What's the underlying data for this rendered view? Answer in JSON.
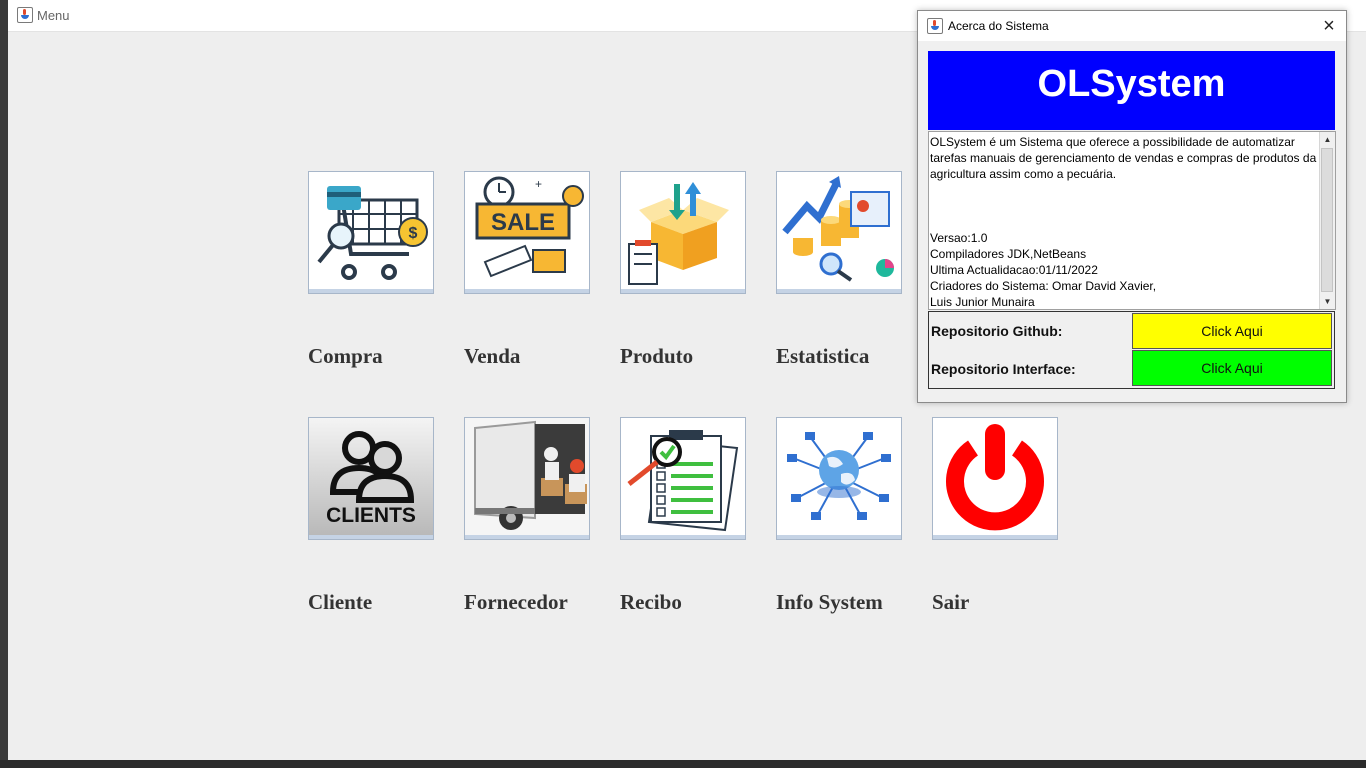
{
  "main_window": {
    "title": "Menu"
  },
  "tiles": [
    {
      "label": "Compra"
    },
    {
      "label": "Venda",
      "sale_text": "SALE"
    },
    {
      "label": "Produto"
    },
    {
      "label": "Estatistica"
    },
    {
      "label": "Cliente",
      "clients_text": "CLIENTS"
    },
    {
      "label": "Fornecedor"
    },
    {
      "label": "Recibo"
    },
    {
      "label": "Info System"
    },
    {
      "label": "Sair"
    }
  ],
  "about": {
    "title": "Acerca do Sistema",
    "banner": "OLSystem",
    "description": "OLSystem é um Sistema que oferece a possibilidade de automatizar tarefas manuais de gerenciamento de vendas e compras de produtos da agricultura assim como a pecuária.",
    "version": "Versao:1.0",
    "compilers": "Compiladores JDK,NetBeans",
    "last_update": "Ultima Actualidacao:01/11/2022",
    "creators_line1": "Criadores do Sistema: Omar David Xavier,",
    "creators_line2": "Luis Junior Munaira",
    "github_label": "Repositorio Github:",
    "github_button": "Click Aqui",
    "interface_label": "Repositorio Interface:",
    "interface_button": "Click Aqui"
  },
  "colors": {
    "banner": "#0000ff",
    "github_button": "#ffff00",
    "interface_button": "#00ff00",
    "power": "#ff0000"
  }
}
